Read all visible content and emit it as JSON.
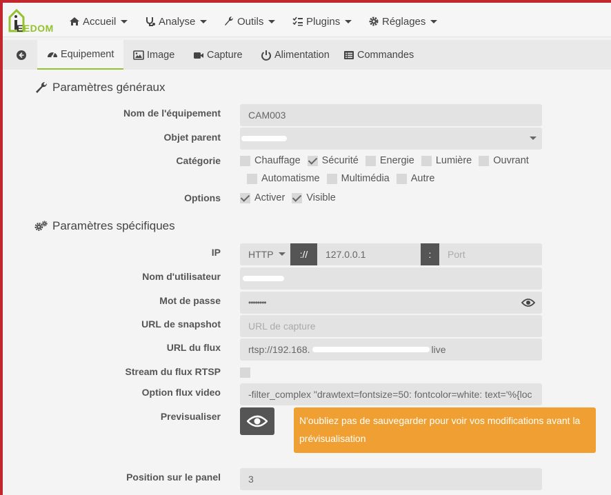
{
  "nav": {
    "logo_l1": "E",
    "logo_l2": "EDOM",
    "items": [
      {
        "label": "Accueil",
        "icon": "home-icon"
      },
      {
        "label": "Analyse",
        "icon": "stethoscope-icon"
      },
      {
        "label": "Outils",
        "icon": "wrench-icon"
      },
      {
        "label": "Plugins",
        "icon": "tasks-icon"
      },
      {
        "label": "Réglages",
        "icon": "cog-icon"
      }
    ]
  },
  "tabs": [
    {
      "label": "",
      "icon": "back-arrow-icon"
    },
    {
      "label": "Equipement",
      "icon": "tachometer-icon",
      "active": true
    },
    {
      "label": "Image",
      "icon": "picture-icon"
    },
    {
      "label": "Capture",
      "icon": "video-camera-icon"
    },
    {
      "label": "Alimentation",
      "icon": "power-icon"
    },
    {
      "label": "Commandes",
      "icon": "list-icon"
    }
  ],
  "general": {
    "title": "Paramètres généraux",
    "name_label": "Nom de l'équipement",
    "name_value": "CAM003",
    "parent_label": "Objet parent",
    "category_label": "Catégorie",
    "categories": [
      {
        "label": "Chauffage",
        "checked": false
      },
      {
        "label": "Sécurité",
        "checked": true
      },
      {
        "label": "Energie",
        "checked": false
      },
      {
        "label": "Lumière",
        "checked": false
      },
      {
        "label": "Ouvrant",
        "checked": false
      },
      {
        "label": "Automatisme",
        "checked": false
      },
      {
        "label": "Multimédia",
        "checked": false
      },
      {
        "label": "Autre",
        "checked": false
      }
    ],
    "options_label": "Options",
    "options": [
      {
        "label": "Activer",
        "checked": true
      },
      {
        "label": "Visible",
        "checked": true
      }
    ]
  },
  "specific": {
    "title": "Paramètres spécifiques",
    "ip_label": "IP",
    "protocol": "HTTP",
    "separator": "://",
    "ip_value": "127.0.0.1",
    "port_sep": ":",
    "port_placeholder": "Port",
    "user_label": "Nom d'utilisateur",
    "password_label": "Mot de passe",
    "password_value": "••••••••",
    "snapshot_label": "URL de snapshot",
    "snapshot_placeholder": "URL de capture",
    "flux_label": "URL du flux",
    "flux_prefix": "rtsp://192.168.",
    "flux_suffix": "live",
    "rtsp_label": "Stream du flux RTSP",
    "rtsp_checked": false,
    "video_option_label": "Option flux video",
    "video_option_value": "-filter_complex \"drawtext=fontsize=50: fontcolor=white: text='%{loc",
    "preview_label": "Previsualiser",
    "alert_text": "N'oubliez pas de sauvegarder pour voir vos modifications avant la prévisualisation",
    "position_label": "Position sur le panel",
    "position_value": "3"
  },
  "colors": {
    "accent": "#94c12e",
    "alert": "#f0a032",
    "frame": "#c0282d"
  }
}
